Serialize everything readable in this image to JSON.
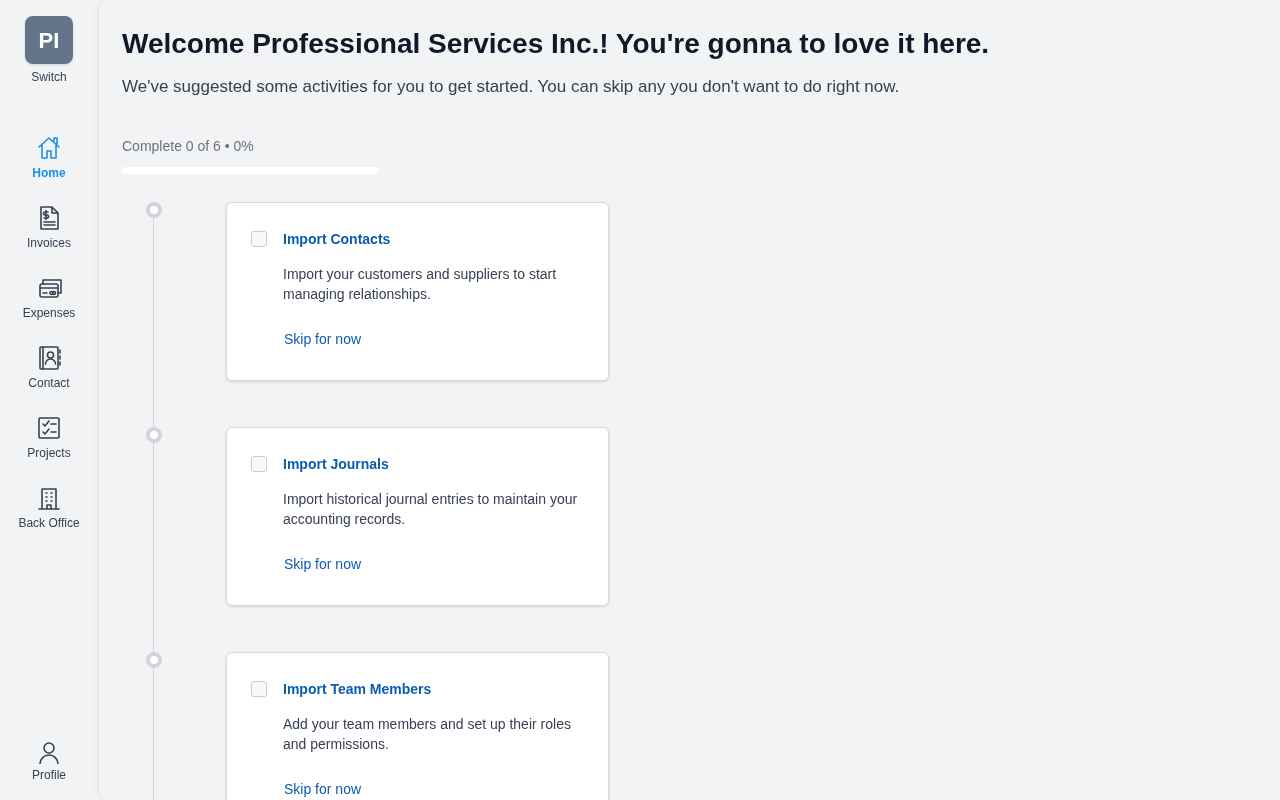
{
  "workspace": {
    "initials": "PI",
    "label": "Switch"
  },
  "sidebar": {
    "items": [
      {
        "label": "Home",
        "selected": true
      },
      {
        "label": "Invoices",
        "selected": false
      },
      {
        "label": "Expenses",
        "selected": false
      },
      {
        "label": "Contact",
        "selected": false
      },
      {
        "label": "Projects",
        "selected": false
      },
      {
        "label": "Back Office",
        "selected": false
      }
    ],
    "profile": {
      "label": "Profile"
    }
  },
  "heading": "Welcome Professional Services Inc.! You're gonna to love it here.",
  "subheading": "We've suggested some activities for you to get started. You can skip any you don't want to do right now.",
  "progress": {
    "label": "Complete 0 of 6 • 0%",
    "level": 0
  },
  "tasks": [
    {
      "title": "Import Contacts",
      "description": "Import your customers and suppliers to start managing relationships.",
      "action": "Skip for now",
      "checked": false
    },
    {
      "title": "Import Journals",
      "description": "Import historical journal entries to maintain your accounting records.",
      "action": "Skip for now",
      "checked": false
    },
    {
      "title": "Import Team Members",
      "description": "Add your team members and set up their roles and permissions.",
      "action": "Skip for now",
      "checked": false
    }
  ]
}
